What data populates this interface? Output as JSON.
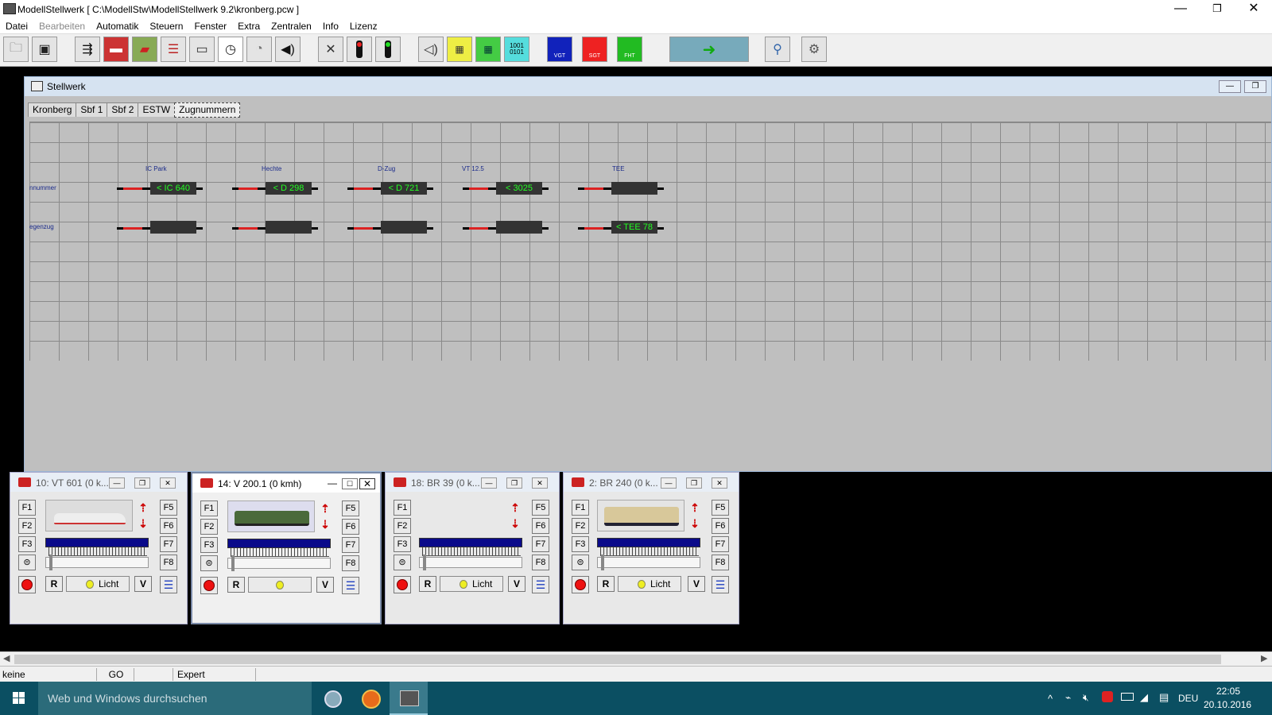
{
  "window": {
    "title": "ModellStellwerk [ C:\\ModellStw\\ModellStellwerk 9.2\\kronberg.pcw ]",
    "min": "—",
    "max": "❐",
    "close": "✕"
  },
  "menu": {
    "items": [
      "Datei",
      "Bearbeiten",
      "Automatik",
      "Steuern",
      "Fenster",
      "Extra",
      "Zentralen",
      "Info",
      "Lizenz"
    ]
  },
  "toolbar": {
    "icons": [
      "open-folder-icon",
      "save-icon",
      "track-layout-icon",
      "train-red-icon",
      "train-photo-icon",
      "train-list-icon",
      "turntable-icon",
      "clock-icon",
      "speedometer-icon",
      "sound-icon",
      "tools-icon",
      "signal-red-icon",
      "signal-green-icon",
      "speaker-icon",
      "keyboard-yellow-icon",
      "keyboard-green-icon",
      "binary-icon",
      "station-blue-icon",
      "station-red-icon",
      "station-green-icon",
      "transfer-icon",
      "search-icon",
      "settings-icon"
    ],
    "labels": {
      "tbl_vp": "VGT",
      "tbl_sg": "SGT",
      "tbl_fht": "FHT",
      "binary": "1001\n0101"
    }
  },
  "stellwerk": {
    "title": "Stellwerk",
    "tabs": [
      "Kronberg",
      "Sbf 1",
      "Sbf 2",
      "ESTW",
      "Zugnummern"
    ],
    "active_tab": "Zugnummern",
    "row_labels": [
      "nnummer",
      "egenzug"
    ],
    "blocks": [
      {
        "label": "IC Park",
        "top": "< IC 640",
        "bottom": ""
      },
      {
        "label": "Hechte",
        "top": "< D 298",
        "bottom": ""
      },
      {
        "label": "D-Zug",
        "top": "< D 721",
        "bottom": ""
      },
      {
        "label": "VT 12.5",
        "top": "< 3025",
        "bottom": ""
      },
      {
        "label": "TEE",
        "top": "",
        "bottom": "< TEE 78"
      }
    ]
  },
  "throttles": [
    {
      "name": "10: VT 601 (0 k...",
      "licht": "Licht",
      "f_left": [
        "F1",
        "F2",
        "F3"
      ],
      "f_right": [
        "F5",
        "F6",
        "F7",
        "F8"
      ],
      "r": "R",
      "v": "V"
    },
    {
      "name": "14: V 200.1 (0 kmh)",
      "licht": "",
      "f_left": [
        "F1",
        "F2",
        "F3"
      ],
      "f_right": [
        "F5",
        "F6",
        "F7",
        "F8"
      ],
      "r": "R",
      "v": "V"
    },
    {
      "name": "18: BR 39 (0 k...",
      "licht": "Licht",
      "f_left": [
        "F1",
        "F2",
        "F3"
      ],
      "f_right": [
        "F5",
        "F6",
        "F7",
        "F8"
      ],
      "r": "R",
      "v": "V"
    },
    {
      "name": "2: BR 240 (0 k...",
      "licht": "Licht",
      "f_left": [
        "F1",
        "F2",
        "F3"
      ],
      "f_right": [
        "F5",
        "F6",
        "F7",
        "F8"
      ],
      "r": "R",
      "v": "V"
    }
  ],
  "status": {
    "sec1": "keine",
    "sec2": "GO",
    "sec3": "",
    "sec4": "Expert"
  },
  "taskbar": {
    "search_placeholder": "Web und Windows durchsuchen",
    "lang": "DEU",
    "time": "22:05",
    "date": "20.10.2016"
  },
  "colors": {
    "block_text": "#22ff22",
    "accent": "#0b4f62",
    "track_red": "#dd2222"
  }
}
